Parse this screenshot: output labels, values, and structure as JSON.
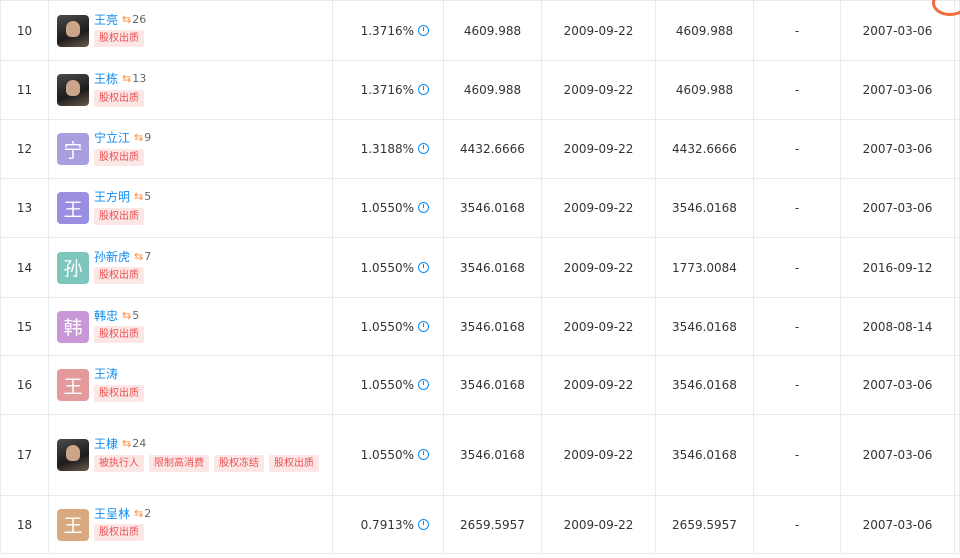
{
  "rows": [
    {
      "idx": "10",
      "name": "王亮",
      "avatar_char": "",
      "avatar_photo": true,
      "avatar_color": "",
      "count": "26",
      "tags": [
        "股权出质"
      ],
      "ratio": "1.3716%",
      "subscribed": "4609.988",
      "sub_date": "2009-09-22",
      "paid": "4609.988",
      "blank": "-",
      "paid_date": "2007-03-06",
      "last": "-"
    },
    {
      "idx": "11",
      "name": "王栋",
      "avatar_char": "",
      "avatar_photo": true,
      "avatar_color": "",
      "count": "13",
      "tags": [
        "股权出质"
      ],
      "ratio": "1.3716%",
      "subscribed": "4609.988",
      "sub_date": "2009-09-22",
      "paid": "4609.988",
      "blank": "-",
      "paid_date": "2007-03-06",
      "last": "-"
    },
    {
      "idx": "12",
      "name": "宁立江",
      "avatar_char": "宁",
      "avatar_photo": false,
      "avatar_color": "#a99ee0",
      "count": "9",
      "tags": [
        "股权出质"
      ],
      "ratio": "1.3188%",
      "subscribed": "4432.6666",
      "sub_date": "2009-09-22",
      "paid": "4432.6666",
      "blank": "-",
      "paid_date": "2007-03-06",
      "last": "-"
    },
    {
      "idx": "13",
      "name": "王方明",
      "avatar_char": "王",
      "avatar_photo": false,
      "avatar_color": "#9a8ee0",
      "count": "5",
      "tags": [
        "股权出质"
      ],
      "ratio": "1.0550%",
      "subscribed": "3546.0168",
      "sub_date": "2009-09-22",
      "paid": "3546.0168",
      "blank": "-",
      "paid_date": "2007-03-06",
      "last": "-"
    },
    {
      "idx": "14",
      "name": "孙新虎",
      "avatar_char": "孙",
      "avatar_photo": false,
      "avatar_color": "#7cc6bc",
      "count": "7",
      "tags": [
        "股权出质"
      ],
      "ratio": "1.0550%",
      "subscribed": "3546.0168",
      "sub_date": "2009-09-22",
      "paid": "1773.0084",
      "blank": "-",
      "paid_date": "2016-09-12",
      "last": "-"
    },
    {
      "idx": "15",
      "name": "韩忠",
      "avatar_char": "韩",
      "avatar_photo": false,
      "avatar_color": "#c996d8",
      "count": "5",
      "tags": [
        "股权出质"
      ],
      "ratio": "1.0550%",
      "subscribed": "3546.0168",
      "sub_date": "2009-09-22",
      "paid": "3546.0168",
      "blank": "-",
      "paid_date": "2008-08-14",
      "last": "-"
    },
    {
      "idx": "16",
      "name": "王涛",
      "avatar_char": "王",
      "avatar_photo": false,
      "avatar_color": "#e29a9a",
      "count": "",
      "tags": [
        "股权出质"
      ],
      "ratio": "1.0550%",
      "subscribed": "3546.0168",
      "sub_date": "2009-09-22",
      "paid": "3546.0168",
      "blank": "-",
      "paid_date": "2007-03-06",
      "last": "-"
    },
    {
      "idx": "17",
      "name": "王棣",
      "avatar_char": "",
      "avatar_photo": true,
      "avatar_color": "",
      "count": "24",
      "tags": [
        "被执行人",
        "限制高消费",
        "股权冻结",
        "股权出质"
      ],
      "ratio": "1.0550%",
      "subscribed": "3546.0168",
      "sub_date": "2009-09-22",
      "paid": "3546.0168",
      "blank": "-",
      "paid_date": "2007-03-06",
      "last": "-"
    },
    {
      "idx": "18",
      "name": "王呈林",
      "avatar_char": "王",
      "avatar_photo": false,
      "avatar_color": "#d9aa7f",
      "count": "2",
      "tags": [
        "股权出质"
      ],
      "ratio": "0.7913%",
      "subscribed": "2659.5957",
      "sub_date": "2009-09-22",
      "paid": "2659.5957",
      "blank": "-",
      "paid_date": "2007-03-06",
      "last": "-"
    }
  ],
  "icons": {
    "share": "share-icon",
    "chart": "pie-chart-icon"
  },
  "colors": {
    "link": "#128bed",
    "tag_bg": "#fde6e6",
    "tag_text": "#ec5252",
    "share": "#fd8c41",
    "border": "#e6ebf1"
  }
}
